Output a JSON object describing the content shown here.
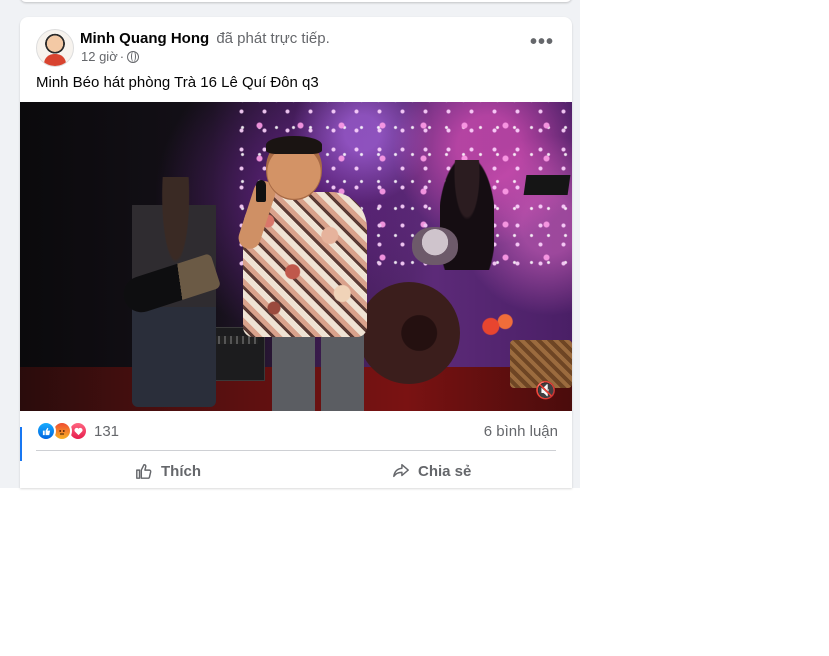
{
  "post": {
    "author_name": "Minh Quang Hong",
    "author_action": "đã phát trực tiếp.",
    "time": "12 giờ",
    "separator": "·",
    "privacy_icon": "globe-icon",
    "more_label": "•••",
    "text": "Minh Béo hát phòng Trà 16 Lê Quí Đôn q3"
  },
  "video": {
    "mute_icon": "speaker-muted-icon",
    "mute_glyph": "🔇"
  },
  "reactions": {
    "icons": [
      "like-reaction-icon",
      "angry-reaction-icon",
      "love-reaction-icon"
    ],
    "count": "131",
    "comments": "6 bình luận"
  },
  "actions": {
    "like_label": "Thích",
    "share_label": "Chia sẻ"
  },
  "colors": {
    "accent": "#1877f2",
    "muted_text": "#65676b",
    "feed_bg": "#f0f2f5"
  }
}
